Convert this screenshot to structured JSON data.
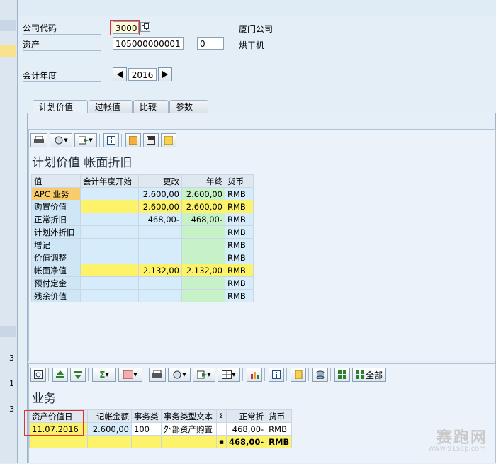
{
  "header": {
    "company_code_label": "公司代码",
    "company_code_value": "3000",
    "company_name": "厦门公司",
    "asset_label": "资产",
    "asset_number": "105000000001",
    "asset_sub_number": "0",
    "asset_description": "烘干机",
    "fiscal_year_label": "会计年度",
    "fiscal_year_value": "2016"
  },
  "left_strip": {
    "numbers": [
      "3",
      "1",
      "3"
    ]
  },
  "tabs": [
    {
      "label": "计划价值",
      "active": true
    },
    {
      "label": "过帐值",
      "active": false
    },
    {
      "label": "比较",
      "active": false
    },
    {
      "label": "参数",
      "active": false
    }
  ],
  "upper_pane": {
    "title": "计划价值 帐面折旧",
    "columns": [
      "值",
      "会计年度开始",
      "更改",
      "年终",
      "货币"
    ],
    "rows": [
      {
        "name": "APC 业务",
        "start": "",
        "change": "2.600,00",
        "end": "2.600,00",
        "currency": "RMB",
        "style": "apc"
      },
      {
        "name": "购置价值",
        "start": "",
        "change": "2.600,00",
        "end": "2.600,00",
        "currency": "RMB",
        "style": "yellow"
      },
      {
        "name": "正常折旧",
        "start": "",
        "change": "468,00-",
        "end": "468,00-",
        "currency": "RMB",
        "style": "plain"
      },
      {
        "name": "计划外折旧",
        "start": "",
        "change": "",
        "end": "",
        "currency": "RMB",
        "style": "plain"
      },
      {
        "name": "增记",
        "start": "",
        "change": "",
        "end": "",
        "currency": "RMB",
        "style": "plain"
      },
      {
        "name": "价值调整",
        "start": "",
        "change": "",
        "end": "",
        "currency": "RMB",
        "style": "plain"
      },
      {
        "name": "帐面净值",
        "start": "",
        "change": "2.132,00",
        "end": "2.132,00",
        "currency": "RMB",
        "style": "yellow"
      },
      {
        "name": "预付定金",
        "start": "",
        "change": "",
        "end": "",
        "currency": "RMB",
        "style": "plain"
      },
      {
        "name": "残余价值",
        "start": "",
        "change": "",
        "end": "",
        "currency": "RMB",
        "style": "plain"
      }
    ]
  },
  "lower_pane": {
    "title": "业务",
    "all_button_label": "全部",
    "columns": [
      "资产价值日",
      "记帐金额",
      "事务类",
      "事务类型文本",
      "Σ",
      "正常折",
      "货币"
    ],
    "rows": [
      {
        "date": "11.07.2016",
        "amount": "2.600,00",
        "type": "100",
        "type_text": "外部资产购置",
        "sigma": "",
        "depr": "468,00-",
        "currency": "RMB"
      }
    ],
    "total": {
      "marker": "■",
      "depr": "468,00-",
      "currency": "RMB"
    }
  },
  "watermark": {
    "text": "赛跑网",
    "url": "www.91sap.com"
  },
  "colors": {
    "highlight_yellow": "#fdf36a",
    "green_column": "#c7f2c7",
    "red_box": "#e03030"
  }
}
